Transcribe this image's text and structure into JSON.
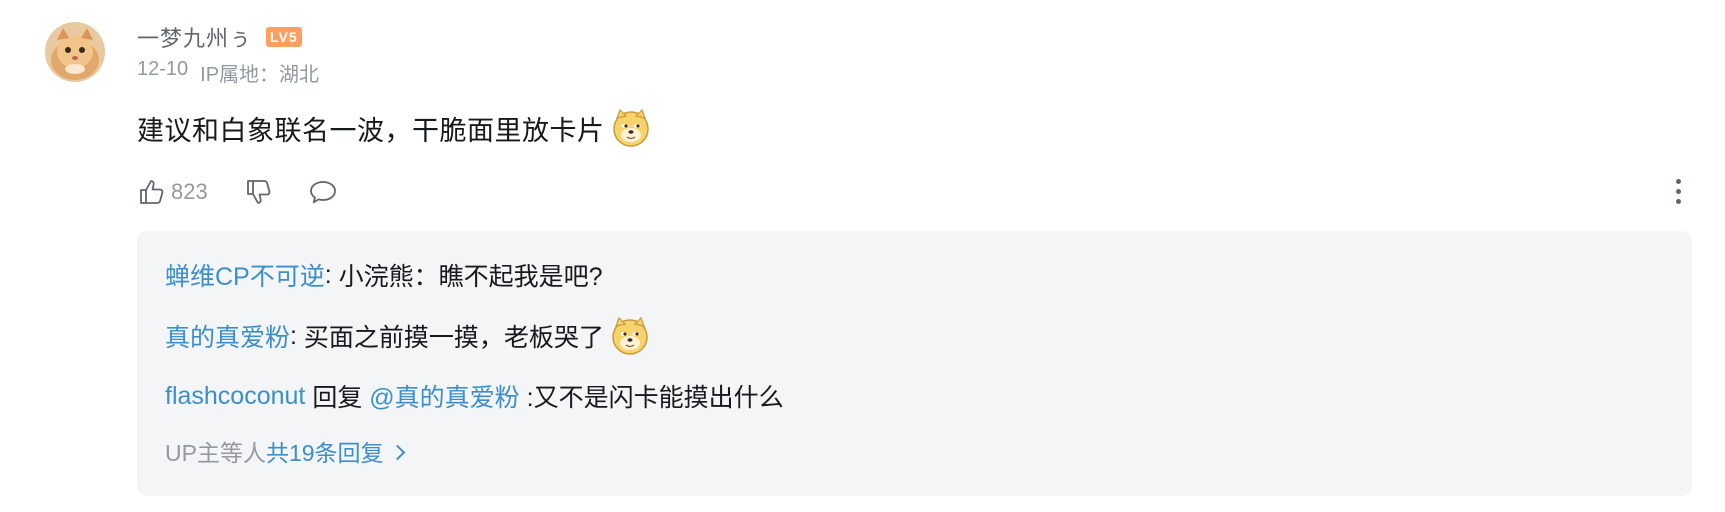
{
  "comment": {
    "username": "一梦九州ぅ",
    "level_badge": "LV5",
    "date": "12-10",
    "ip_location": "IP属地：湖北",
    "text": "建议和白象联名一波，干脆面里放卡片",
    "emoji": "doge-emoji",
    "likes": "823"
  },
  "replies": [
    {
      "user": "蝉维CP不可逆",
      "separator": ": ",
      "text": "小浣熊：瞧不起我是吧?"
    },
    {
      "user": "真的真爱粉",
      "separator": ": ",
      "text": "买面之前摸一摸，老板哭了",
      "emoji": "doge-emoji"
    },
    {
      "user": "flashcoconut",
      "reply_word": " 回复 ",
      "mention": "@真的真爱粉",
      "text": " :又不是闪卡能摸出什么"
    }
  ],
  "reply_summary": {
    "prefix": "UP主等人",
    "link": "共19条回复"
  },
  "colors": {
    "link_blue": "#3c8fc9",
    "gray_text": "#9499a0",
    "reply_bg": "#f4f5f7",
    "level_badge": "#ff9f5f"
  }
}
